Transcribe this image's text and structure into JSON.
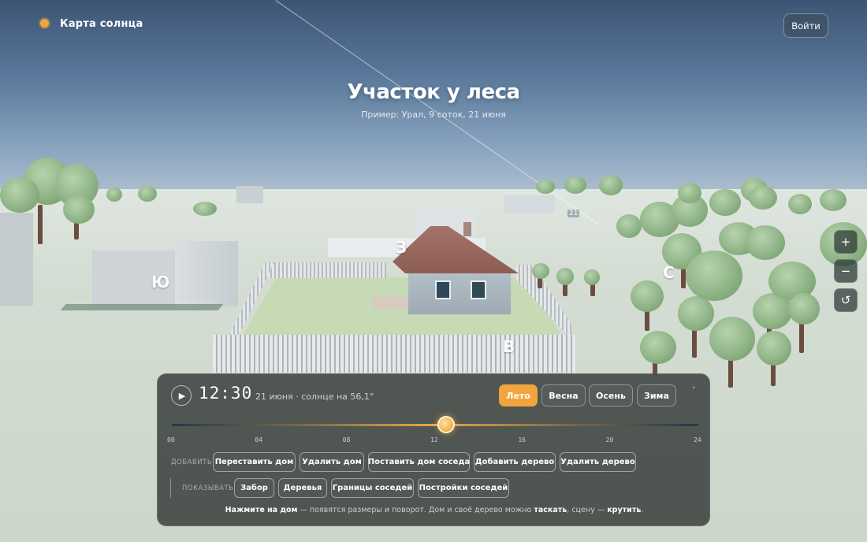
{
  "brand": {
    "title": "Карта солнца",
    "icon": "sun-icon"
  },
  "header": {
    "login_label": "Войти"
  },
  "hero": {
    "title": "Участок у леса",
    "subtitle": "Пример: Урал, 9 соток, 21 июня"
  },
  "scene": {
    "compass": {
      "west": "З",
      "south": "Ю",
      "north": "С",
      "east": "В"
    },
    "marker_label": "21"
  },
  "map_controls": {
    "zoom_in": "+",
    "zoom_out": "−",
    "reset": "↺"
  },
  "panel": {
    "play_icon": "play-icon",
    "time": "12:30",
    "date_info": "21 июня · солнце на 56,1°",
    "seasons": [
      {
        "label": "Лето",
        "active": true
      },
      {
        "label": "Весна",
        "active": false
      },
      {
        "label": "Осень",
        "active": false
      },
      {
        "label": "Зима",
        "active": false
      }
    ],
    "collapse_label": "˅",
    "slider": {
      "value_hours": 12.5,
      "min": 0,
      "max": 24
    },
    "ticks": [
      "00",
      "04",
      "08",
      "12",
      "16",
      "20",
      "24"
    ],
    "add_label": "ДОБАВИТЬ",
    "add_buttons": [
      "Переставить дом",
      "Удалить дом",
      "Поставить дом соседа",
      "Добавить дерево",
      "Удалить дерево"
    ],
    "show_label": "ПОКАЗЫВАТЬ",
    "show_buttons": [
      "Забор",
      "Деревья",
      "Границы соседей",
      "Постройки соседей"
    ],
    "hint": {
      "part1": "Нажмите на дом",
      "part2": " — появятся размеры и поворот. Дом и своё дерево можно ",
      "part3": "таскать",
      "part4": ", сцену — ",
      "part5": "крутить",
      "part6": "."
    }
  }
}
